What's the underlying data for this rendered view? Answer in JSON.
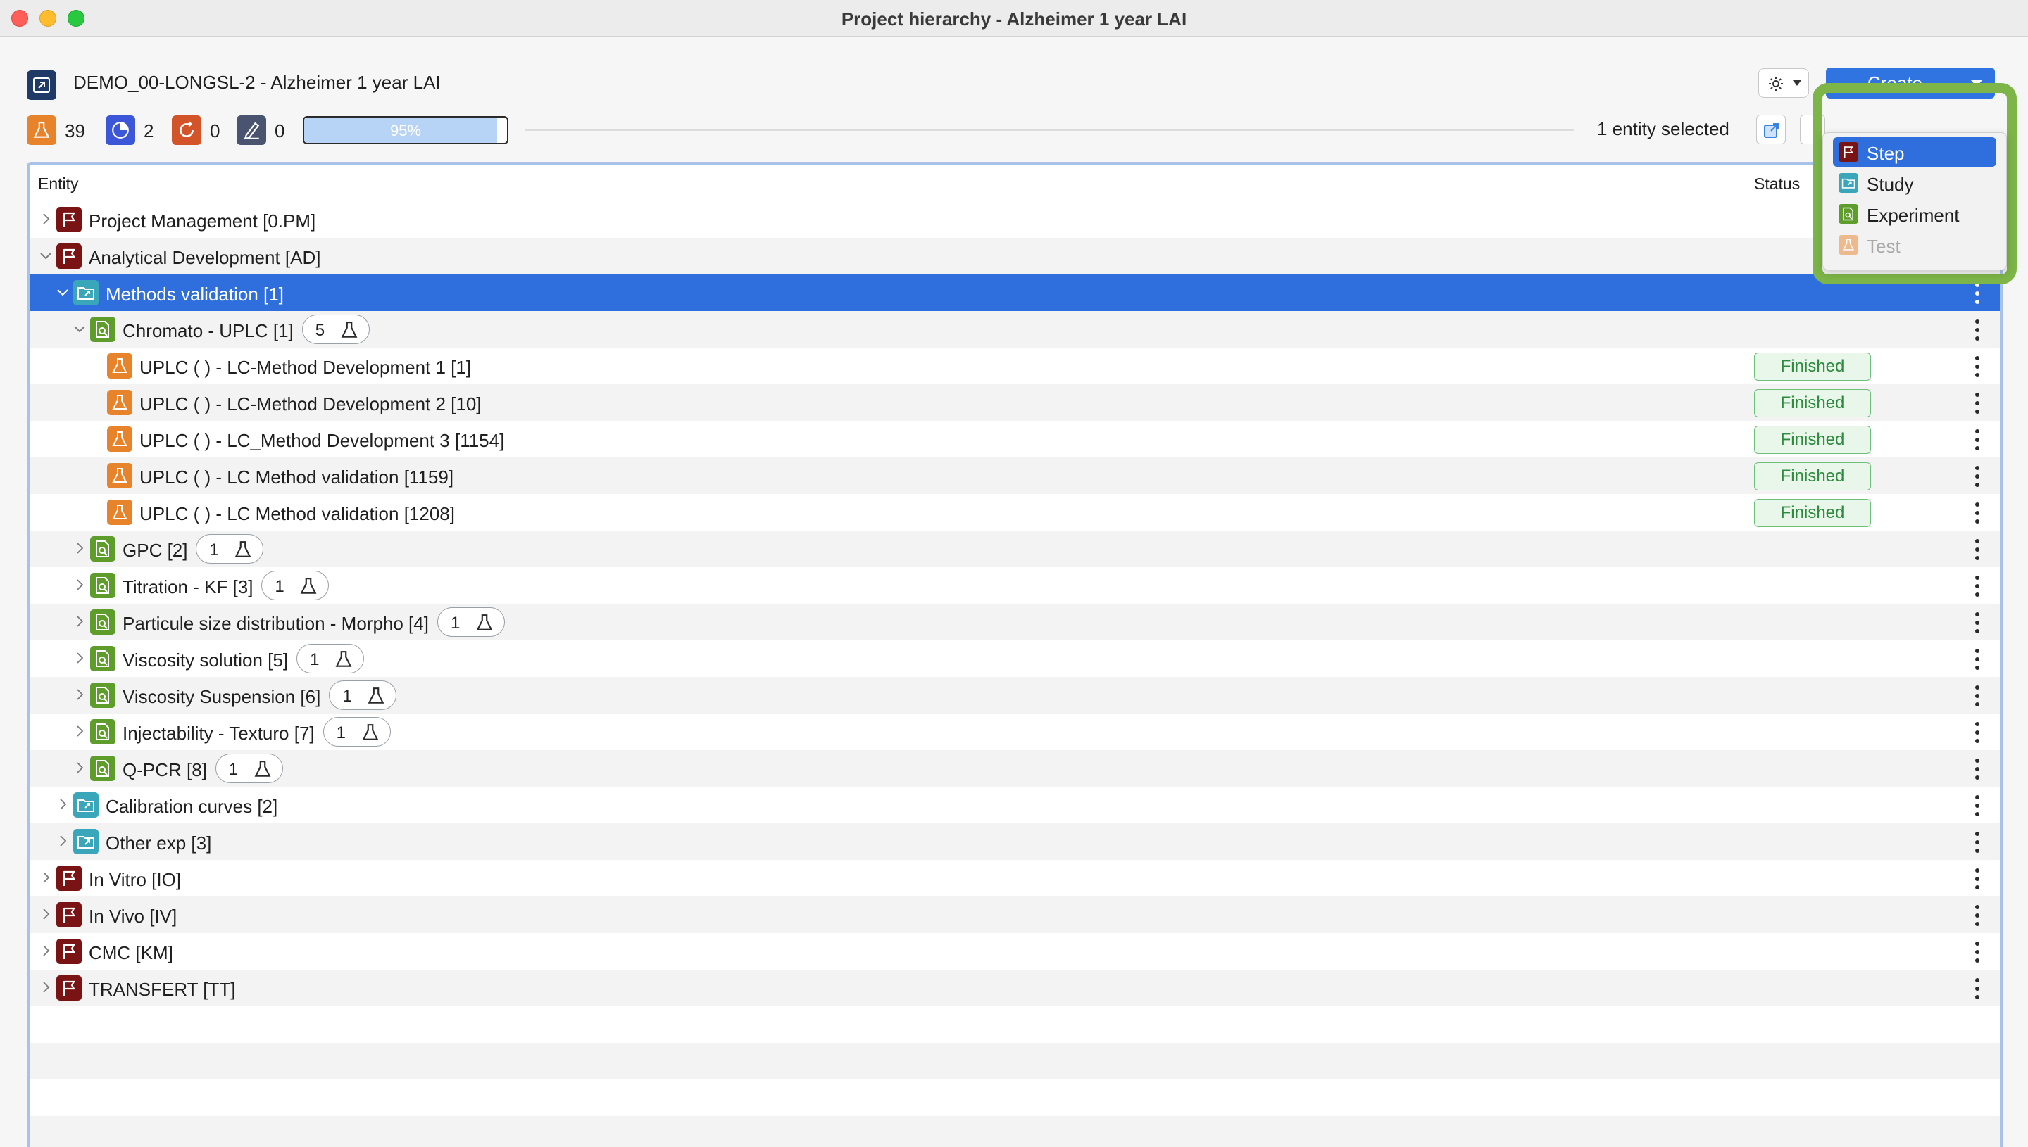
{
  "window": {
    "title": "Project hierarchy - Alzheimer 1 year LAI"
  },
  "header": {
    "project_name": "DEMO_00-LONGSL-2 - Alzheimer 1 year LAI",
    "create_label": "Create",
    "selection_text": "1 entity selected"
  },
  "counters": [
    {
      "icon": "test-flask-icon",
      "value": "39",
      "color": "#e7832b"
    },
    {
      "icon": "pie-progress-icon",
      "value": "2",
      "color": "#3b57d8"
    },
    {
      "icon": "refresh-cycle-icon",
      "value": "0",
      "color": "#d4542a"
    },
    {
      "icon": "pen-sign-icon",
      "value": "0",
      "color": "#4a5470"
    }
  ],
  "progress": {
    "label": "95%",
    "value": 0.95
  },
  "table": {
    "columns": {
      "entity": "Entity",
      "status": "Status"
    },
    "rows": [
      {
        "type": "step",
        "label": "Project Management [0.PM]",
        "indent": 0,
        "expanded": false
      },
      {
        "type": "step",
        "label": "Analytical Development [AD]",
        "indent": 0,
        "expanded": true
      },
      {
        "type": "study",
        "label": "Methods validation [1]",
        "indent": 1,
        "expanded": true,
        "selected": true
      },
      {
        "type": "experiment",
        "label": "Chromato - UPLC [1]",
        "indent": 2,
        "expanded": true,
        "count": "5"
      },
      {
        "type": "test",
        "label": "UPLC ( ) - LC-Method Development 1 [1]",
        "indent": 3,
        "status": "Finished"
      },
      {
        "type": "test",
        "label": "UPLC ( ) - LC-Method Development 2 [10]",
        "indent": 3,
        "status": "Finished"
      },
      {
        "type": "test",
        "label": "UPLC ( ) - LC_Method Development 3 [1154]",
        "indent": 3,
        "status": "Finished"
      },
      {
        "type": "test",
        "label": "UPLC ( ) - LC Method validation [1159]",
        "indent": 3,
        "status": "Finished"
      },
      {
        "type": "test",
        "label": "UPLC ( ) - LC Method validation [1208]",
        "indent": 3,
        "status": "Finished"
      },
      {
        "type": "experiment",
        "label": "GPC [2]",
        "indent": 2,
        "expanded": false,
        "count": "1"
      },
      {
        "type": "experiment",
        "label": "Titration - KF [3]",
        "indent": 2,
        "expanded": false,
        "count": "1"
      },
      {
        "type": "experiment",
        "label": "Particule size distribution - Morpho [4]",
        "indent": 2,
        "expanded": false,
        "count": "1"
      },
      {
        "type": "experiment",
        "label": "Viscosity solution [5]",
        "indent": 2,
        "expanded": false,
        "count": "1"
      },
      {
        "type": "experiment",
        "label": "Viscosity Suspension [6]",
        "indent": 2,
        "expanded": false,
        "count": "1"
      },
      {
        "type": "experiment",
        "label": "Injectability - Texturo [7]",
        "indent": 2,
        "expanded": false,
        "count": "1"
      },
      {
        "type": "experiment",
        "label": "Q-PCR [8]",
        "indent": 2,
        "expanded": false,
        "count": "1"
      },
      {
        "type": "study",
        "label": "Calibration curves [2]",
        "indent": 1,
        "expanded": false
      },
      {
        "type": "study",
        "label": "Other exp [3]",
        "indent": 1,
        "expanded": false
      },
      {
        "type": "step",
        "label": "In Vitro [IO]",
        "indent": 0,
        "expanded": false
      },
      {
        "type": "step",
        "label": "In Vivo [IV]",
        "indent": 0,
        "expanded": false
      },
      {
        "type": "step",
        "label": "CMC [KM]",
        "indent": 0,
        "expanded": false
      },
      {
        "type": "step",
        "label": "TRANSFERT [TT]",
        "indent": 0,
        "expanded": false
      }
    ]
  },
  "create_menu": {
    "items": [
      {
        "type": "step",
        "label": "Step",
        "active": true,
        "disabled": false
      },
      {
        "type": "study",
        "label": "Study",
        "active": false,
        "disabled": false
      },
      {
        "type": "experiment",
        "label": "Experiment",
        "active": false,
        "disabled": false
      },
      {
        "type": "test",
        "label": "Test",
        "active": false,
        "disabled": true
      }
    ]
  },
  "colors": {
    "step": "#7a1313",
    "study": "#3aa6b9",
    "experiment": "#5e9c2c",
    "test": "#e7832b",
    "selection": "#2f6fdd",
    "status_finished": "#2e8b3e",
    "highlight_outline": "#7db548"
  }
}
